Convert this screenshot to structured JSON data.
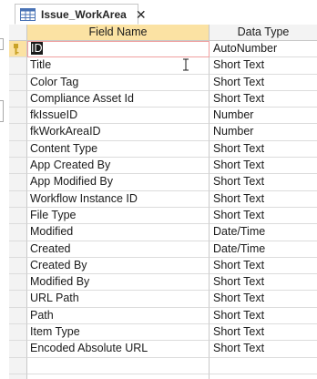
{
  "tab": {
    "title": "Issue_WorkArea",
    "icon": "table-icon",
    "close_glyph": "✕"
  },
  "grid": {
    "columns": [
      "Field Name",
      "Data Type"
    ],
    "rows": [
      {
        "field": "ID",
        "type": "AutoNumber",
        "primary_key": true
      },
      {
        "field": "Title",
        "type": "Short Text"
      },
      {
        "field": "Color Tag",
        "type": "Short Text"
      },
      {
        "field": "Compliance Asset Id",
        "type": "Short Text"
      },
      {
        "field": "fkIssueID",
        "type": "Number"
      },
      {
        "field": "fkWorkAreaID",
        "type": "Number"
      },
      {
        "field": "Content Type",
        "type": "Short Text"
      },
      {
        "field": "App Created By",
        "type": "Short Text"
      },
      {
        "field": "App Modified By",
        "type": "Short Text"
      },
      {
        "field": "Workflow Instance ID",
        "type": "Short Text"
      },
      {
        "field": "File Type",
        "type": "Short Text"
      },
      {
        "field": "Modified",
        "type": "Date/Time"
      },
      {
        "field": "Created",
        "type": "Date/Time"
      },
      {
        "field": "Created By",
        "type": "Short Text"
      },
      {
        "field": "Modified By",
        "type": "Short Text"
      },
      {
        "field": "URL Path",
        "type": "Short Text"
      },
      {
        "field": "Path",
        "type": "Short Text"
      },
      {
        "field": "Item Type",
        "type": "Short Text"
      },
      {
        "field": "Encoded Absolute URL",
        "type": "Short Text"
      },
      {
        "field": "",
        "type": ""
      },
      {
        "field": "",
        "type": ""
      }
    ]
  },
  "colors": {
    "header_highlight": "#fbe2a3",
    "key_icon": "#c9a227"
  }
}
